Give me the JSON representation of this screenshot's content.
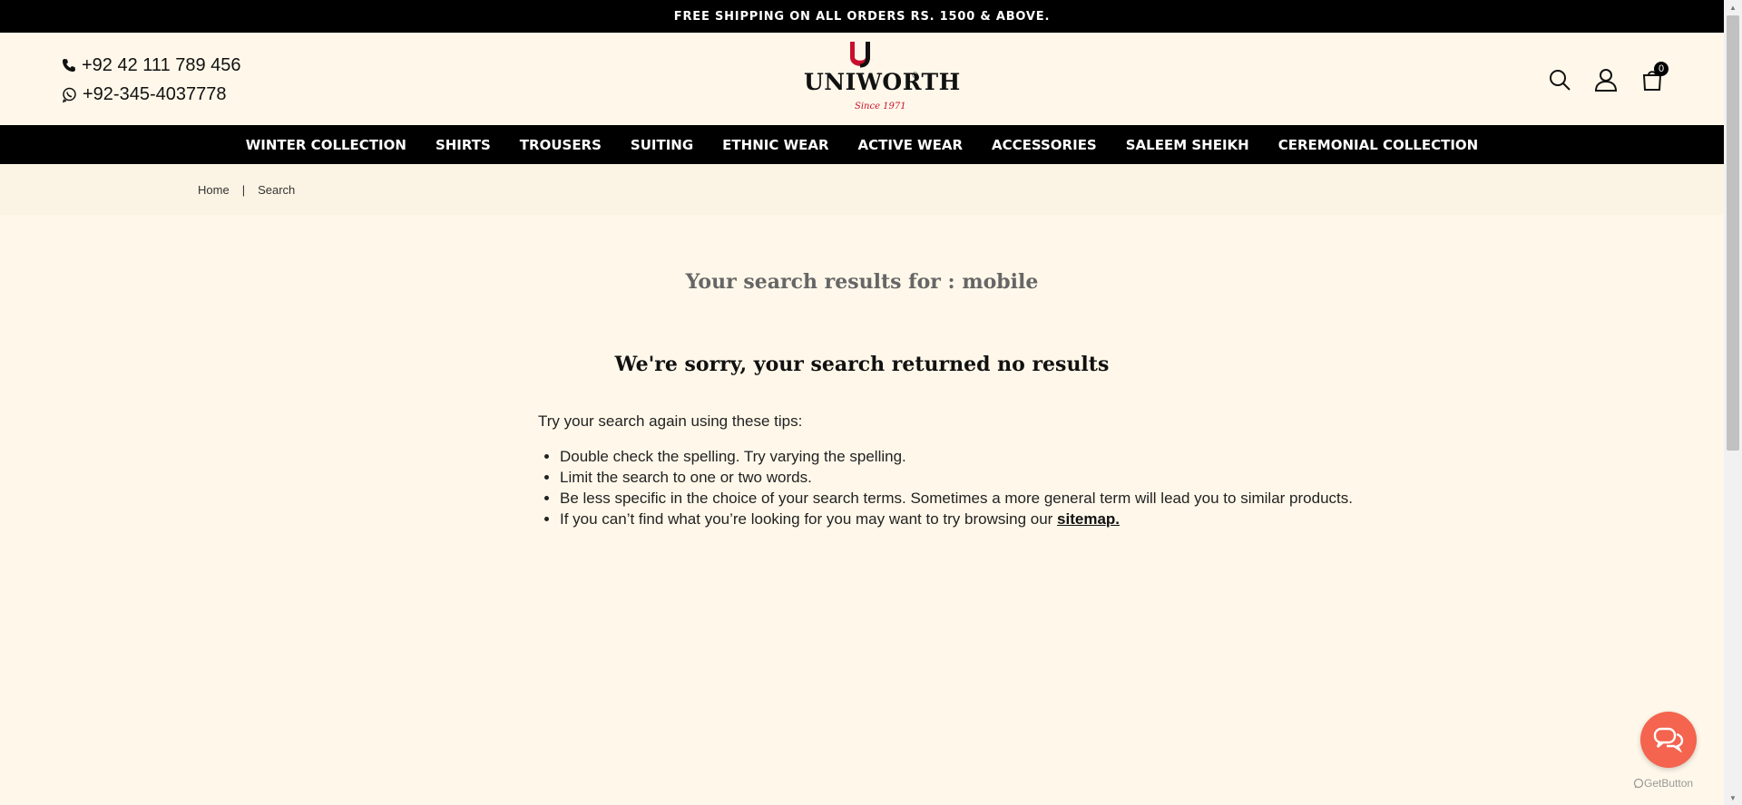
{
  "announcement": "FREE SHIPPING ON ALL ORDERS RS. 1500 & ABOVE.",
  "header": {
    "phone": "+92 42 111 789 456",
    "whatsapp": "+92-345-4037778",
    "logo": {
      "wordmark": "UNIWORTH",
      "tagline": "Since 1971",
      "registered": "®"
    },
    "cart_count": "0",
    "icons": [
      "search-icon",
      "user-icon",
      "cart-icon"
    ]
  },
  "nav": {
    "items": [
      {
        "label": "WINTER COLLECTION"
      },
      {
        "label": "SHIRTS"
      },
      {
        "label": "TROUSERS"
      },
      {
        "label": "SUITING"
      },
      {
        "label": "ETHNIC WEAR"
      },
      {
        "label": "ACTIVE WEAR"
      },
      {
        "label": "ACCESSORIES"
      },
      {
        "label": "SALEEM SHEIKH"
      },
      {
        "label": "CEREMONIAL COLLECTION"
      }
    ]
  },
  "breadcrumb": {
    "home": "Home",
    "separator": "|",
    "current": "Search"
  },
  "search": {
    "results_title": "Your search results for : mobile",
    "no_results": "We're sorry, your search returned no results",
    "tips_intro": "Try your search again using these tips:",
    "tips": [
      "Double check the spelling. Try varying the spelling.",
      "Limit the search to one or two words.",
      "Be less specific in the choice of your search terms. Sometimes a more general term will lead you to similar products."
    ],
    "last_tip_prefix": "If you can’t find what you’re looking for you may want to try browsing our ",
    "sitemap_link": "sitemap."
  },
  "widget": {
    "brand": "GetButton"
  },
  "colors": {
    "background": "#fff8ea",
    "bar": "#000000",
    "logo_red": "#c8102e",
    "chat": "#f4644e"
  }
}
